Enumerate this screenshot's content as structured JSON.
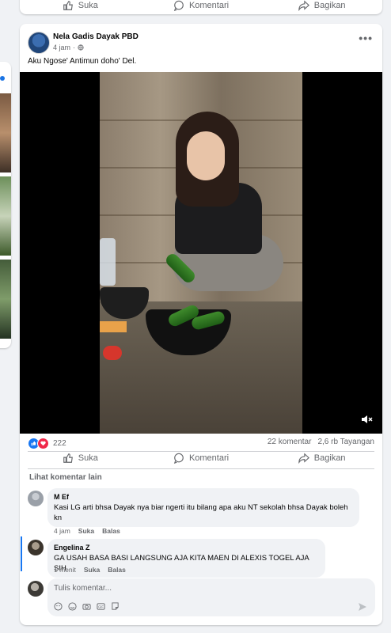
{
  "actions": {
    "like": "Suka",
    "comment": "Komentari",
    "share": "Bagikan"
  },
  "post": {
    "author": "Nela Gadis Dayak PBD",
    "time": "4 jam",
    "text": "Aku Ngose' Antimun doho' Del."
  },
  "stats": {
    "reactions": "222",
    "comments": "22 komentar",
    "views": "2,6 rb Tayangan"
  },
  "more_comments": "Lihat komentar lain",
  "comments": [
    {
      "name": "M Ef",
      "text": "Kasi LG arti bhsa Dayak nya biar ngerti itu bilang apa aku NT sekolah bhsa Dayak boleh kn",
      "time": "4 jam",
      "like": "Suka",
      "reply": "Balas"
    },
    {
      "name": "Engelina Z",
      "text": "GA USAH BASA BASI LANGSUNG AJA KITA MAEN DI ALEXIS TOGEL AJA SIH",
      "time": "1 menit",
      "like": "Suka",
      "reply": "Balas"
    }
  ],
  "comment_input": {
    "placeholder": "Tulis komentar..."
  },
  "colors": {
    "accent": "#1877f2",
    "love": "#f02849",
    "muted": "#65676b",
    "bubble": "#f0f2f5"
  }
}
